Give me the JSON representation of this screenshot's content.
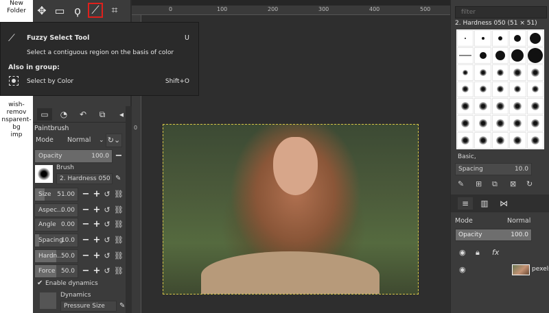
{
  "desktop": {
    "folder_line1": "New",
    "folder_line2": "Folder",
    "file_line1": "wish-remov",
    "file_line2": "nsparent-bg",
    "file_line3": "imp"
  },
  "tooltip": {
    "title": "Fuzzy Select Tool",
    "shortcut": "U",
    "description": "Select a contiguous region on the basis of color",
    "group_heading": "Also in group:",
    "group_item_label": "Select by Color",
    "group_item_shortcut": "Shift+O"
  },
  "tool_options": {
    "title": "Paintbrush",
    "mode_label": "Mode",
    "mode_value": "Normal",
    "opacity_label": "Opacity",
    "opacity_value": "100.0",
    "brush_label": "Brush",
    "brush_name": "2. Hardness 050",
    "size_label": "Size",
    "size_value": "51.00",
    "aspect_label": "Aspec...",
    "aspect_value": "0.00",
    "angle_label": "Angle",
    "angle_value": "0.00",
    "spacing_label": "Spacing",
    "spacing_value": "10.0",
    "hardness_label": "Hardn...",
    "hardness_value": "50.0",
    "force_label": "Force",
    "force_value": "50.0",
    "enable_dynamics": "Enable dynamics",
    "dynamics_label": "Dynamics",
    "dynamics_name": "Pressure Size"
  },
  "ruler": {
    "top_ticks": [
      "0",
      "100",
      "200",
      "300",
      "400",
      "500"
    ],
    "left_ticks": [
      "0"
    ]
  },
  "brushes_panel": {
    "filter_placeholder": "filter",
    "title": "2. Hardness 050 (51 × 51)",
    "preset": "Basic,",
    "spacing_label": "Spacing",
    "spacing_value": "10.0"
  },
  "layers_panel": {
    "mode_label": "Mode",
    "mode_value": "Normal",
    "opacity_label": "Opacity",
    "opacity_value": "100.0",
    "layer_name": "pexels-"
  },
  "colors": {
    "highlight": "#e0201c",
    "selection_border": "#d8c648"
  }
}
